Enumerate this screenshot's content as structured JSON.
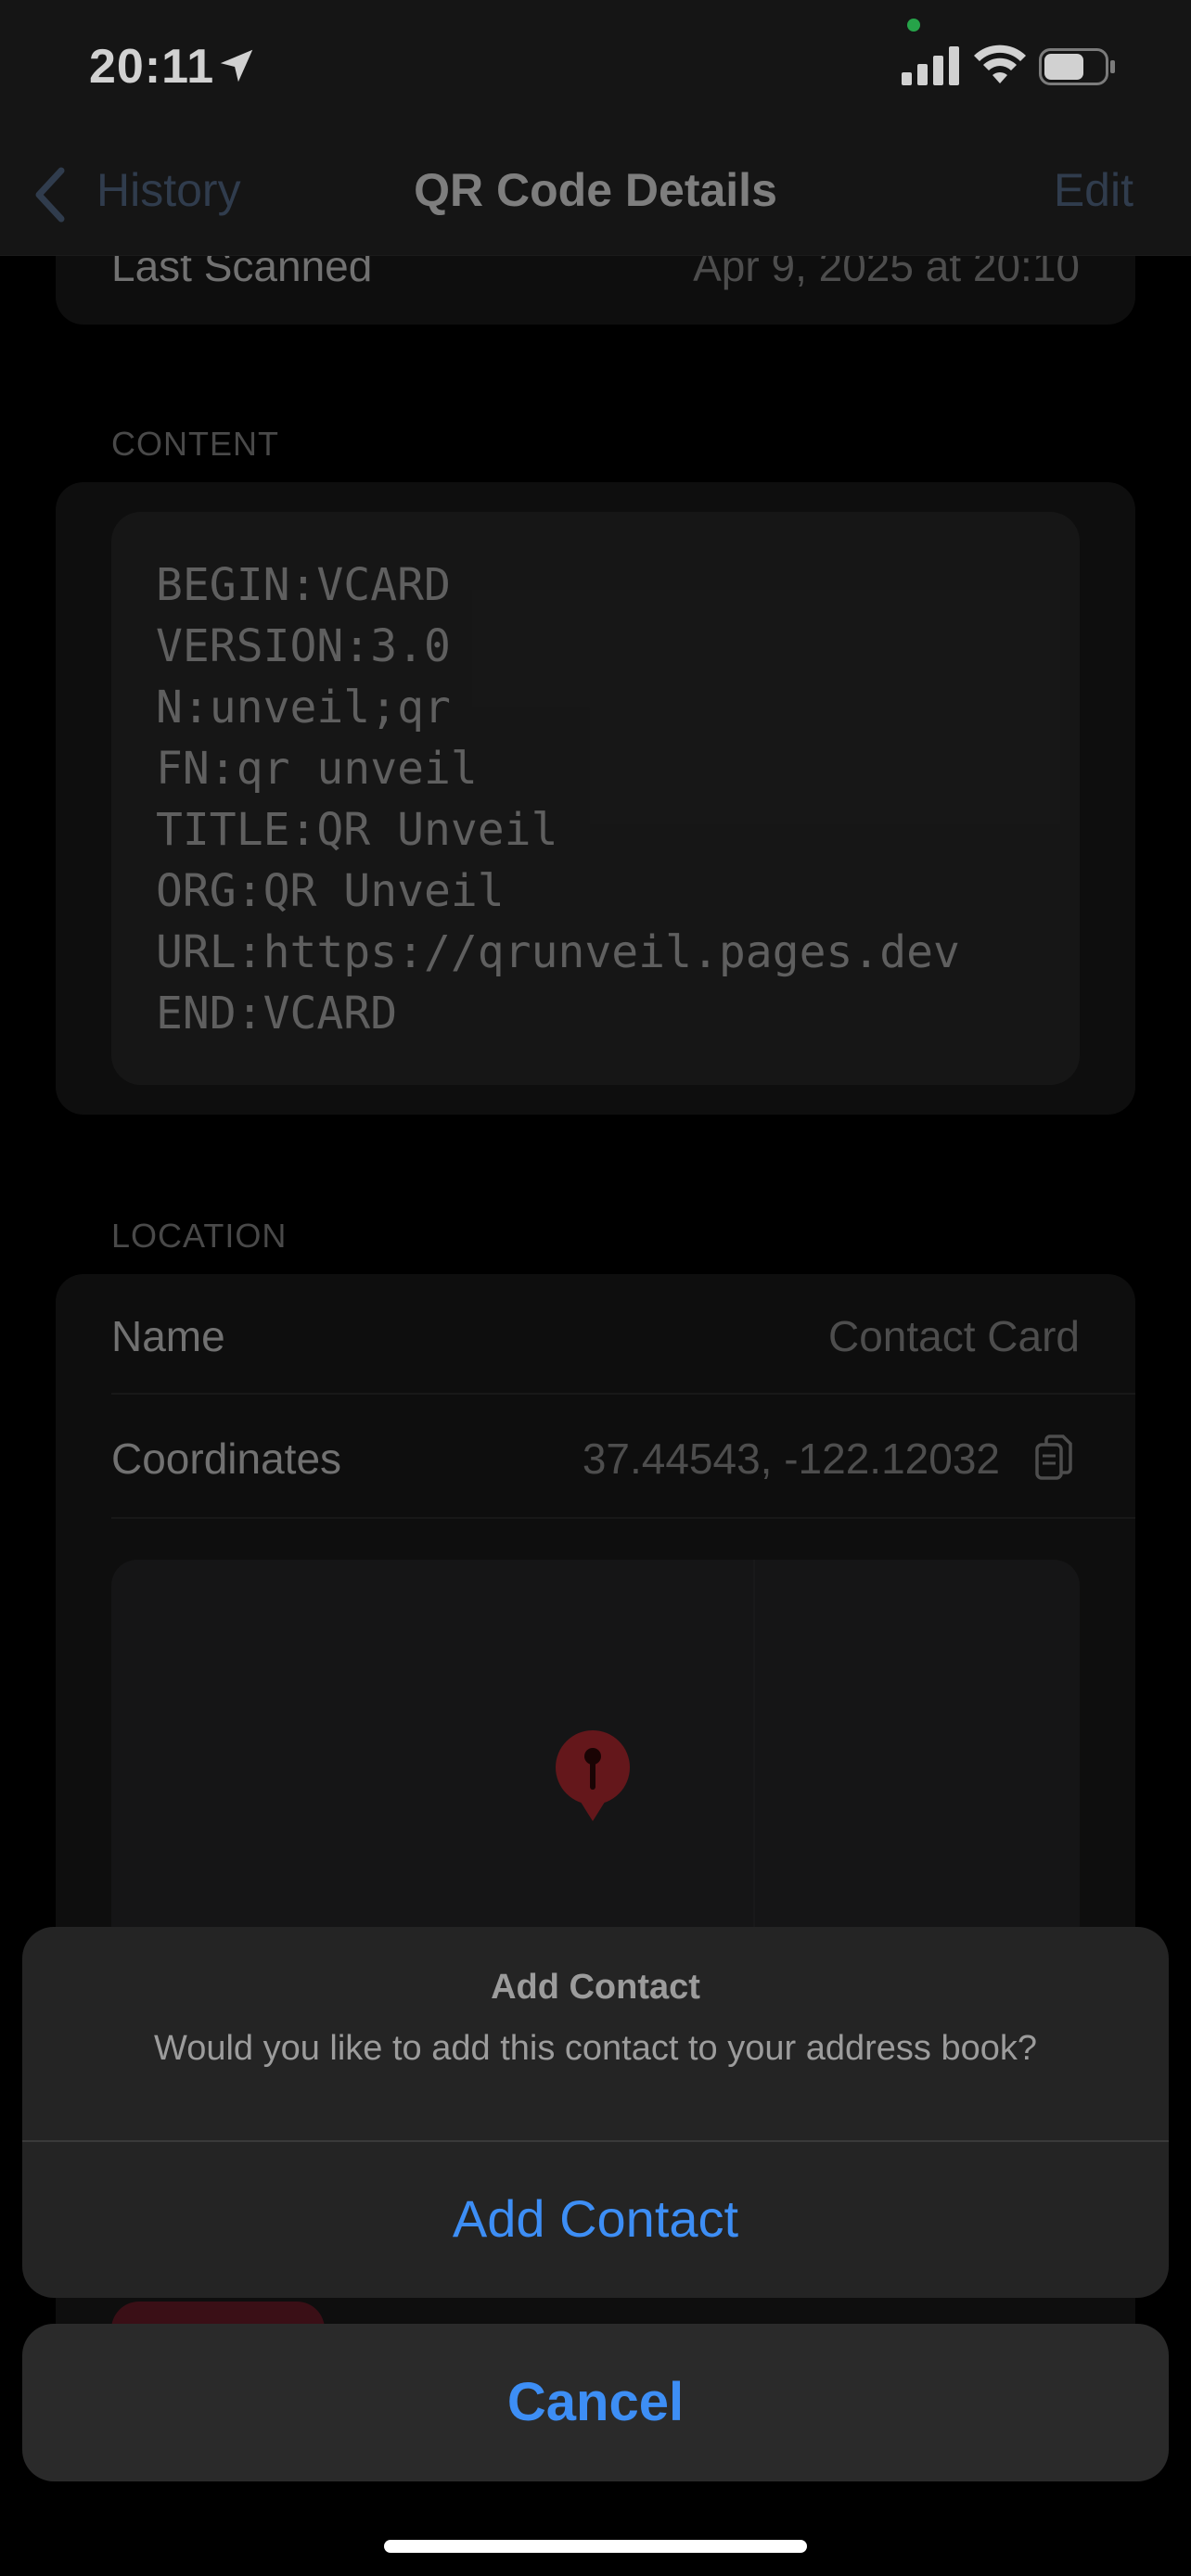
{
  "status_bar": {
    "time": "20:11",
    "icons": [
      "location-arrow-icon",
      "signal-icon",
      "wifi-icon",
      "battery-icon"
    ],
    "privacy_dot_color": "#2fc75a"
  },
  "nav": {
    "back_label": "History",
    "title": "QR Code Details",
    "edit_label": "Edit"
  },
  "details": {
    "last_scanned_label": "Last Scanned",
    "last_scanned_value": "Apr 9, 2025 at 20:10"
  },
  "content_section": {
    "title": "CONTENT",
    "lines": [
      "BEGIN:VCARD",
      "VERSION:3.0",
      "N:unveil;qr",
      "FN:qr unveil",
      "TITLE:QR Unveil",
      "ORG:QR Unveil",
      "URL:https://qrunveil.pages.dev",
      "END:VCARD"
    ]
  },
  "location_section": {
    "title": "LOCATION",
    "name_label": "Name",
    "name_value": "Contact Card",
    "coords_label": "Coordinates",
    "coords_value": "37.44543, -122.12032"
  },
  "action_sheet": {
    "title": "Add Contact",
    "message": "Would you like to add this contact to your address book?",
    "action_label": "Add Contact",
    "cancel_label": "Cancel",
    "accent_color": "#3d8ef5"
  }
}
